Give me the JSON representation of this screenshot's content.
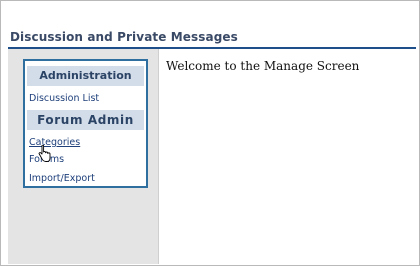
{
  "header": {
    "title": "Discussion and Private Messages"
  },
  "sidebar": {
    "sections": [
      {
        "label": "Administration",
        "items": [
          {
            "label": "Discussion List"
          }
        ]
      },
      {
        "label": "Forum Admin",
        "items": [
          {
            "label": "Categories"
          },
          {
            "label": "Forums"
          },
          {
            "label": "Import/Export"
          }
        ]
      }
    ]
  },
  "main": {
    "welcome": "Welcome to the Manage Screen"
  },
  "icons": {
    "cursor": "hand-pointer-icon"
  },
  "colors": {
    "accent": "#1f4f8a",
    "menu_border": "#2f6f9f",
    "section_bg": "#d3dce9",
    "link": "#1e3f7a"
  }
}
